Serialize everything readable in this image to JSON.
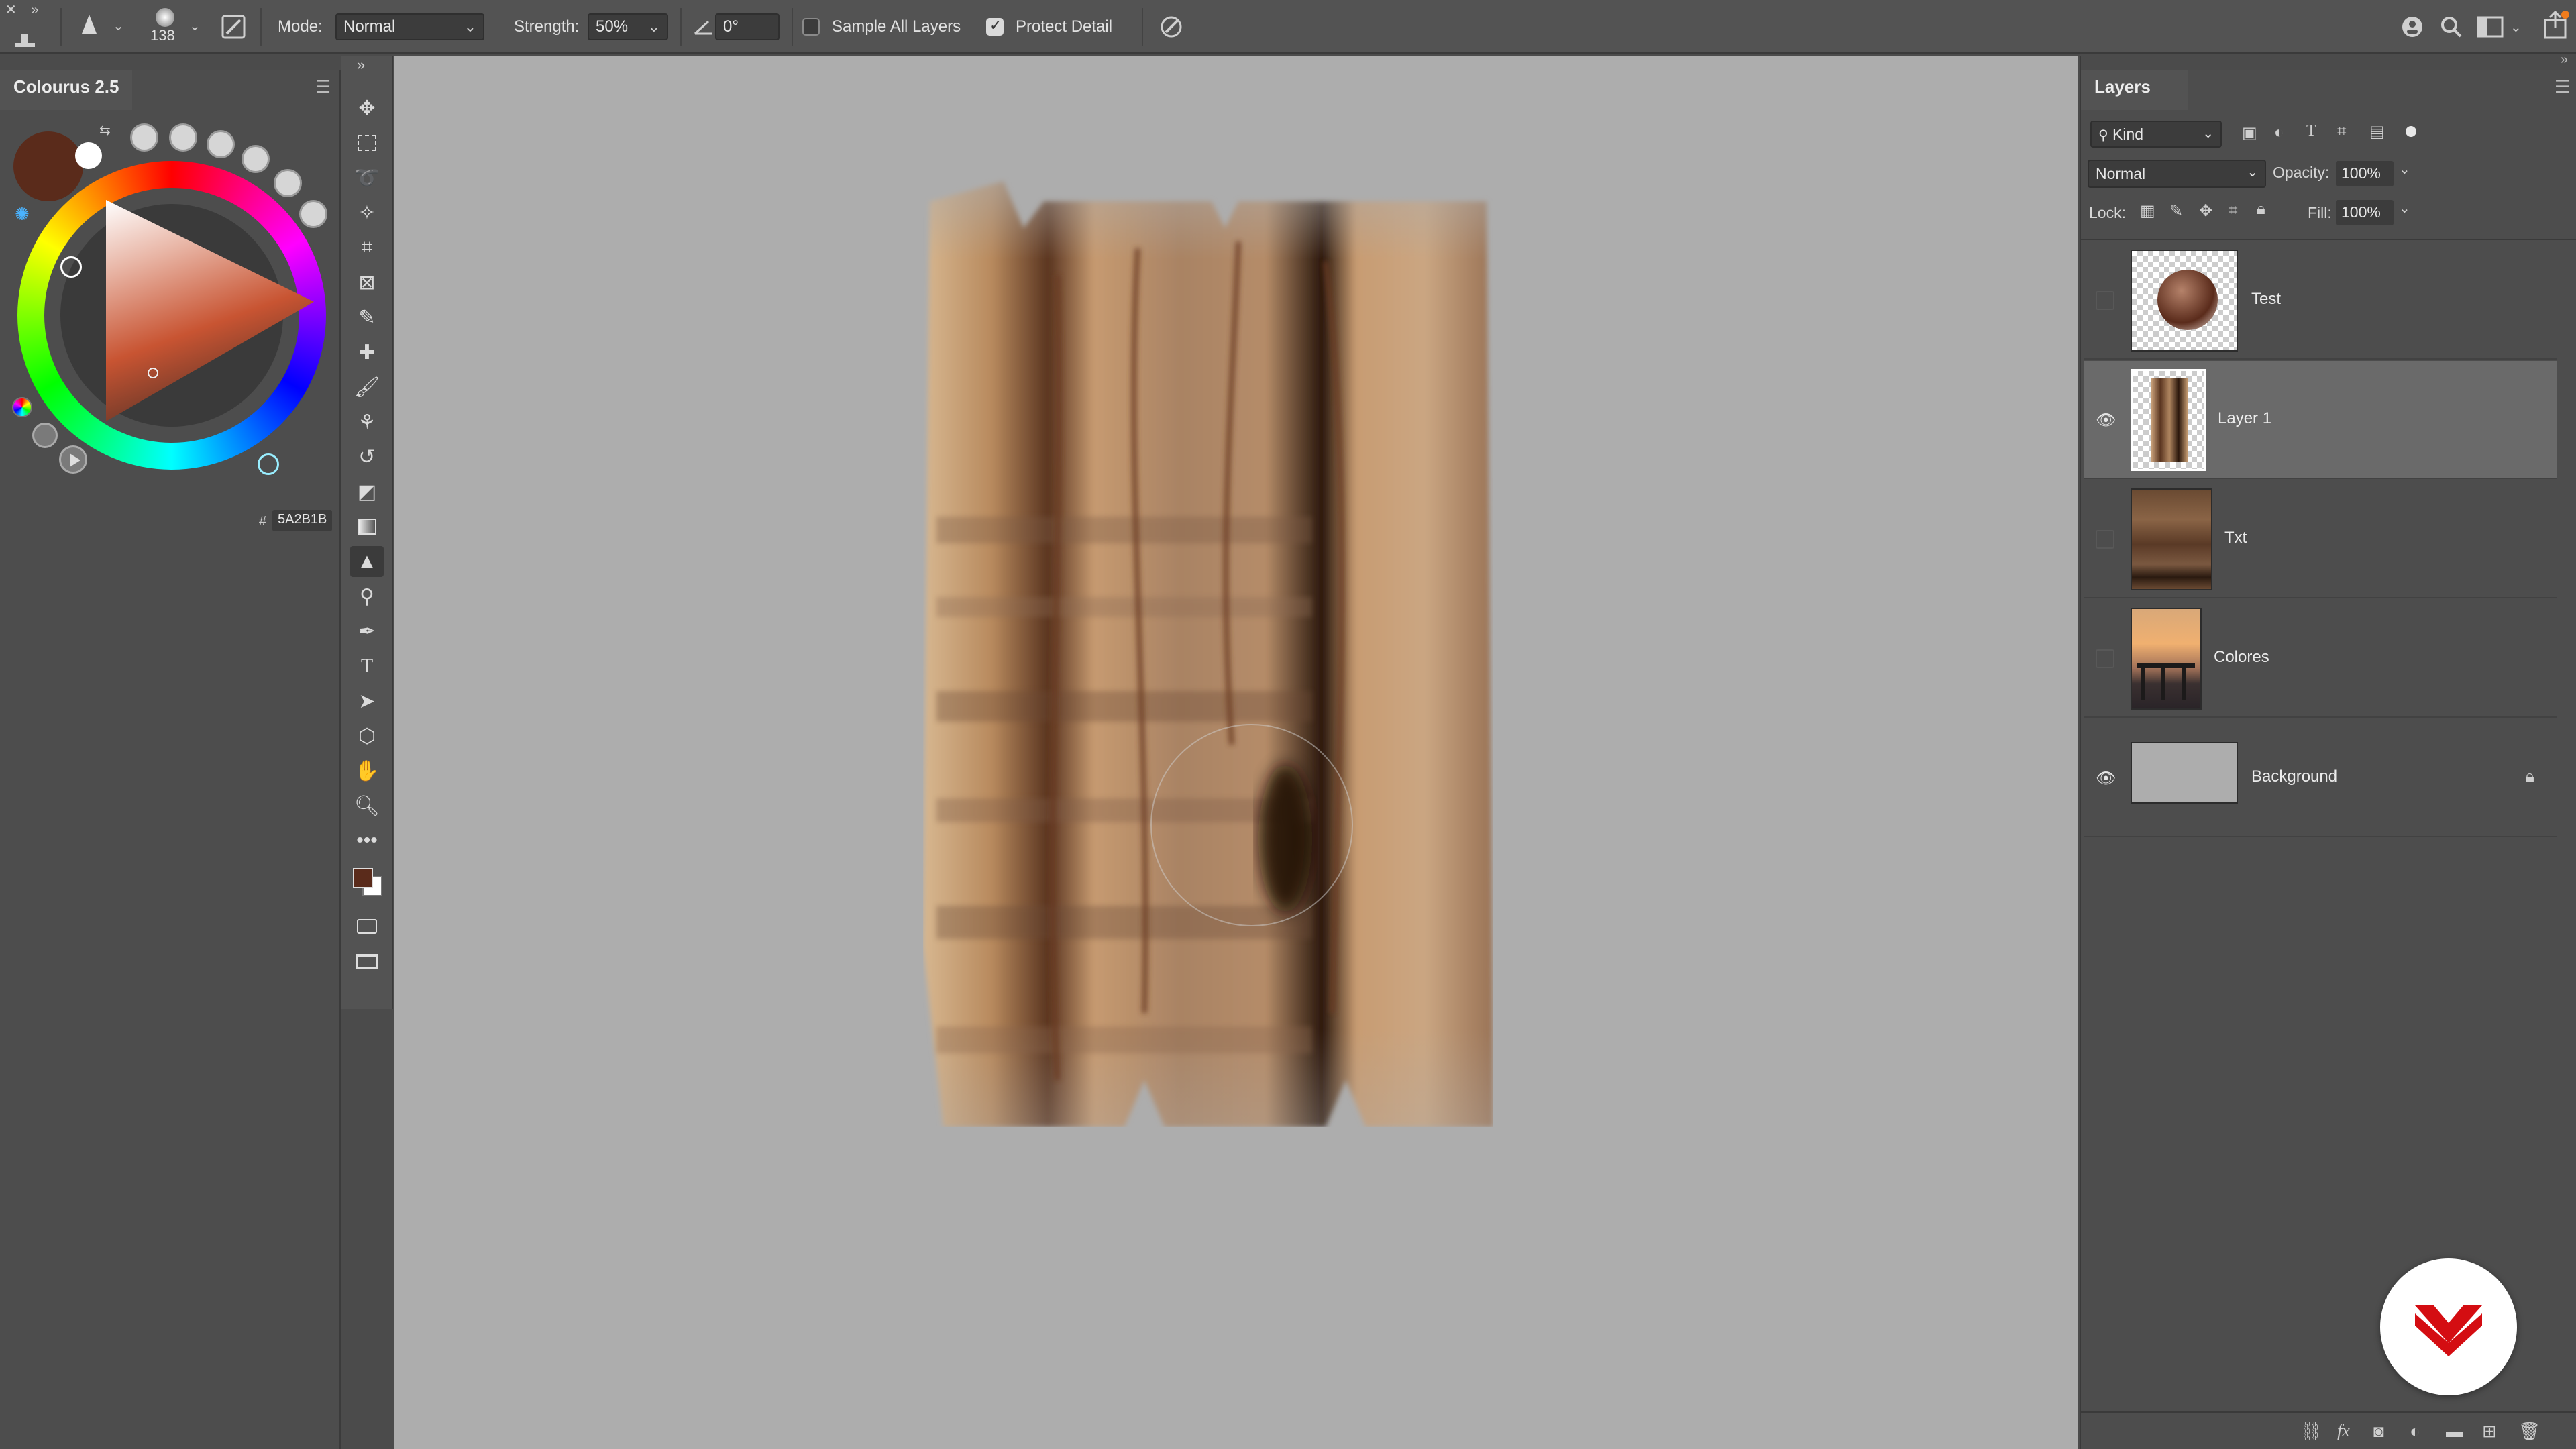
{
  "options_bar": {
    "brush_size": "138",
    "mode_label": "Mode:",
    "mode_value": "Normal",
    "strength_label": "Strength:",
    "strength_value": "50%",
    "angle_value": "0°",
    "sample_all_layers_label": "Sample All Layers",
    "sample_all_layers_checked": false,
    "protect_detail_label": "Protect Detail",
    "protect_detail_checked": true,
    "icons": [
      "smudge-tool-icon",
      "brush-preset-icon",
      "brush-settings-icon",
      "angle-icon",
      "pressure-icon",
      "learn-icon",
      "search-icon",
      "workspace-icon",
      "share-icon"
    ]
  },
  "colourus": {
    "title": "Colourus 2.5",
    "hex_prefix": "#",
    "hex_value": "5A2B1B",
    "foreground_color": "#5a2b1b",
    "background_color": "#ffffff"
  },
  "toolbar": {
    "tools": [
      "move",
      "marquee",
      "lasso",
      "magic-wand",
      "crop",
      "frame",
      "eyedropper",
      "healing",
      "brush",
      "clone-stamp",
      "history-brush",
      "eraser",
      "gradient",
      "smudge",
      "dodge",
      "pen",
      "type",
      "path-select",
      "shape",
      "hand",
      "zoom",
      "more"
    ],
    "active_tool": "smudge"
  },
  "layers": {
    "title": "Layers",
    "filter_kind": "Kind",
    "blend_mode": "Normal",
    "opacity_label": "Opacity:",
    "opacity_value": "100%",
    "lock_label": "Lock:",
    "fill_label": "Fill:",
    "fill_value": "100%",
    "items": [
      {
        "name": "Test",
        "visible": false,
        "selected": false,
        "locked": false
      },
      {
        "name": "Layer 1",
        "visible": true,
        "selected": true,
        "locked": false
      },
      {
        "name": "Txt",
        "visible": false,
        "selected": false,
        "locked": false
      },
      {
        "name": "Colores",
        "visible": false,
        "selected": false,
        "locked": false
      },
      {
        "name": "Background",
        "visible": true,
        "selected": false,
        "locked": true
      }
    ]
  },
  "canvas": {
    "background_color": "#adadad"
  }
}
